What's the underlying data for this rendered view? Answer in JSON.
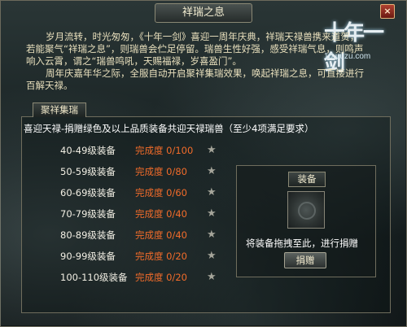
{
  "window": {
    "title": "祥瑞之息",
    "close_icon": "×"
  },
  "logo": {
    "text": "十年一剑",
    "url": "10.uuzu.com"
  },
  "intro": {
    "paragraph1": "岁月流转，时光匆匆，《十年一剑》喜迎一周年庆典，祥瑞天禄兽携来道贺，若能聚气“祥瑞之息”，则瑞兽会伫足停留。瑞兽生性好强，感受祥瑞气息，则鸣声响入云霄，谓之“瑞兽鸣吼，天赐福禄，岁喜盈门”。",
    "paragraph2": "周年庆嘉年华之际，全服自动开启聚祥集瑞效果，唤起祥瑞之息，可直接进行百解天禄。"
  },
  "section": {
    "tab_label": "聚祥集瑞",
    "requirement": "喜迎天禄-捐赠绿色及以上品质装备共迎天禄瑞兽（至少4项满足要求）",
    "rows": [
      {
        "level": "40-49级装备",
        "progress_label": "完成度",
        "progress": "0/100",
        "star": "★"
      },
      {
        "level": "50-59级装备",
        "progress_label": "完成度",
        "progress": "0/80",
        "star": "★"
      },
      {
        "level": "60-69级装备",
        "progress_label": "完成度",
        "progress": "0/60",
        "star": "★"
      },
      {
        "level": "70-79级装备",
        "progress_label": "完成度",
        "progress": "0/40",
        "star": "★"
      },
      {
        "level": "80-89级装备",
        "progress_label": "完成度",
        "progress": "0/40",
        "star": "★"
      },
      {
        "level": "90-99级装备",
        "progress_label": "完成度",
        "progress": "0/20",
        "star": "★"
      },
      {
        "level": "100-110级装备",
        "progress_label": "完成度",
        "progress": "0/20",
        "star": "★"
      }
    ]
  },
  "equip": {
    "label": "装备",
    "hint": "将装备拖拽至此，进行捐赠",
    "donate_button": "捐赠"
  },
  "colors": {
    "progress": "#f36c2a",
    "star": "#a5a59a",
    "intro_text": "#e9e0bd"
  }
}
